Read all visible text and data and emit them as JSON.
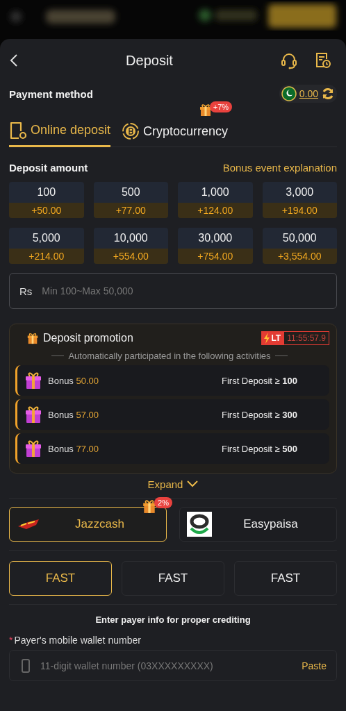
{
  "header": {
    "title": "Deposit"
  },
  "payment_method": {
    "label": "Payment method",
    "balance": "0.00"
  },
  "tabs": [
    {
      "label": "Online deposit",
      "selected": true
    },
    {
      "label": "Cryptocurrency",
      "selected": false,
      "badge": "+7%"
    }
  ],
  "deposit_amount": {
    "label": "Deposit amount",
    "link": "Bonus event explanation"
  },
  "amounts": [
    {
      "amount": "100",
      "bonus": "+50.00"
    },
    {
      "amount": "500",
      "bonus": "+77.00"
    },
    {
      "amount": "1,000",
      "bonus": "+124.00"
    },
    {
      "amount": "3,000",
      "bonus": "+194.00"
    },
    {
      "amount": "5,000",
      "bonus": "+214.00"
    },
    {
      "amount": "10,000",
      "bonus": "+554.00"
    },
    {
      "amount": "30,000",
      "bonus": "+754.00"
    },
    {
      "amount": "50,000",
      "bonus": "+3,554.00"
    }
  ],
  "amount_field": {
    "currency": "Rs",
    "placeholder": "Min 100~Max 50,000"
  },
  "promotion": {
    "title": "Deposit promotion",
    "tag": "LT",
    "timer": "11:55:57.9",
    "subtitle": "Automatically participated in the following activities",
    "items": [
      {
        "label": "Bonus",
        "amount": "50.00",
        "condition": "First Deposit ≥ **100**"
      },
      {
        "label": "Bonus",
        "amount": "57.00",
        "condition": "First Deposit ≥ **300**"
      },
      {
        "label": "Bonus",
        "amount": "77.00",
        "condition": "First Deposit ≥ **500**"
      }
    ]
  },
  "expand": "Expand",
  "channels": [
    {
      "name": "Jazzcash",
      "selected": true,
      "badge": "2%",
      "kind": "jazzcash"
    },
    {
      "name": "Easypaisa",
      "selected": false,
      "kind": "easypaisa"
    }
  ],
  "speeds": [
    {
      "label": "FAST",
      "selected": true
    },
    {
      "label": "FAST",
      "selected": false
    },
    {
      "label": "FAST",
      "selected": false
    }
  ],
  "payer_info": {
    "note": "Enter payer info for proper crediting",
    "label": "Payer's mobile wallet number",
    "required_mark": "*",
    "placeholder": "11-digit wallet number (03XXXXXXXXX)",
    "paste": "Paste"
  }
}
